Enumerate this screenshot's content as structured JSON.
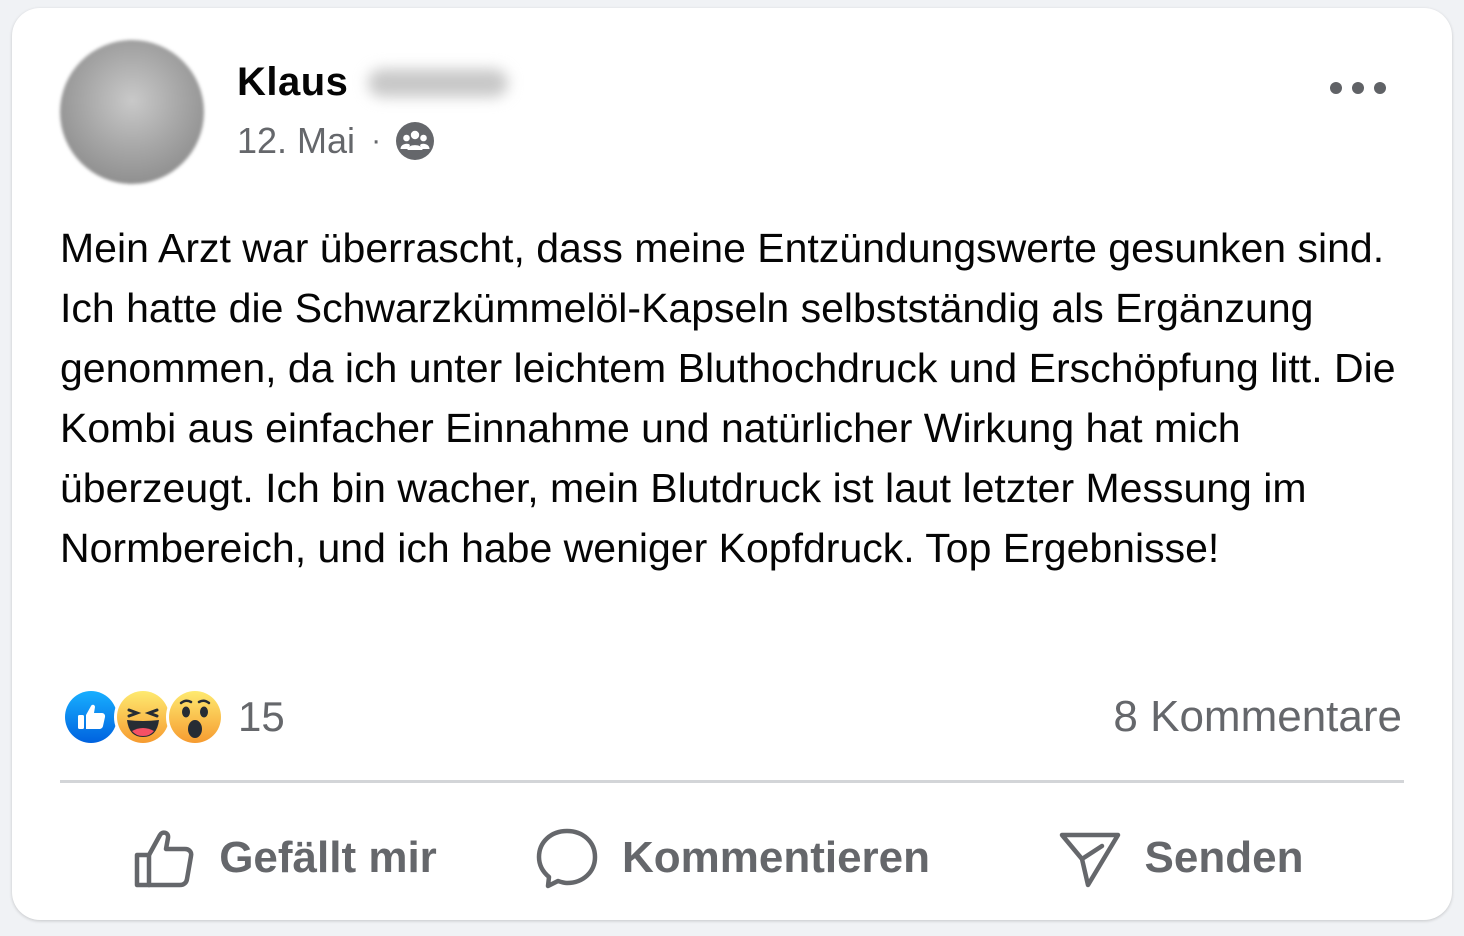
{
  "post": {
    "author_first_name": "Klaus",
    "date": "12. Mai",
    "separator": "·",
    "audience_icon": "group-icon",
    "more_icon": "more-options-icon",
    "text": "Mein Arzt war überrascht, dass meine Entzündungswerte gesunken sind. Ich hatte die Schwarzkümmelöl-Kapseln selbstständig als Ergänzung genommen, da ich unter leichtem Bluthochdruck und Erschöpfung litt. Die Kombi aus einfacher Einnahme und natürlicher Wirkung hat mich überzeugt. Ich bin wacher, mein Blutdruck ist laut letzter Messung im Normbereich, und ich habe weniger Kopfdruck. Top Ergebnisse!"
  },
  "reactions": {
    "types": [
      "like",
      "haha",
      "wow"
    ],
    "count": "15",
    "comments_label": "8 Kommentare"
  },
  "actions": {
    "like_label": "Gefällt mir",
    "comment_label": "Kommentieren",
    "send_label": "Senden"
  },
  "colors": {
    "like_blue": "#1877f2",
    "emoji_yellow": "#f7b928",
    "secondary_text": "#65676b",
    "divider": "#d3d5d8"
  }
}
